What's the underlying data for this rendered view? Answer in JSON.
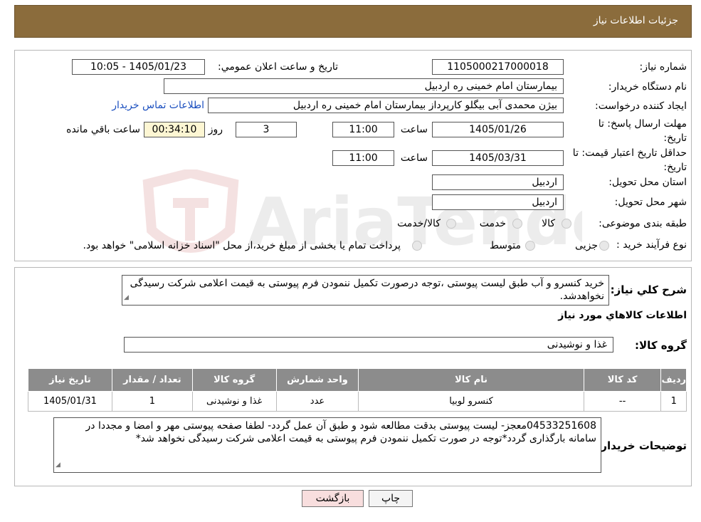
{
  "header": {
    "title": "جزئیات اطلاعات نیاز"
  },
  "form": {
    "need_number_label": "شماره نیاز:",
    "need_number": "1105000217000018",
    "announce_label": "تاریخ و ساعت اعلان عمومي:",
    "announce_value": "1405/01/23 - 10:05",
    "buyer_org_label": "نام دستگاه خریدار:",
    "buyer_org": "بیمارستان امام خمینی  ره  اردبیل",
    "requester_label": "ایجاد کننده درخواست:",
    "requester": "بیژن محمدی آبی بیگلو کارپرداز بیمارستان امام خمینی  ره  اردبیل",
    "contact_link": "اطلاعات تماس خریدار",
    "deadline_label": "مهلت ارسال پاسخ: تا تاریخ:",
    "deadline_date": "1405/01/26",
    "time_label": "ساعت",
    "deadline_time": "11:00",
    "days": "3",
    "days_label": "روز و",
    "remaining": "00:34:10",
    "remaining_label": "ساعت باقي مانده",
    "validity_label": "حداقل تاریخ اعتبار قیمت: تا تاریخ:",
    "validity_date": "1405/03/31",
    "validity_time": "11:00",
    "province_label": "استان محل تحویل:",
    "province": "اردبیل",
    "city_label": "شهر محل تحویل:",
    "city": "اردبیل",
    "category_label": "طبقه بندی موضوعی:",
    "category_options": [
      "کالا",
      "خدمت",
      "کالا/خدمت"
    ],
    "process_label": "نوع فرآیند خرید :",
    "process_options": [
      "جزیی",
      "متوسط"
    ],
    "process_note": "پرداخت تمام یا بخشی از مبلغ خرید،از محل \"اسناد خزانه اسلامی\" خواهد بود."
  },
  "description": {
    "label": "شرح کلي نياز:",
    "text": "خرید کنسرو و آب طبق لیست پیوستی ،توجه درصورت تکمیل ننمودن فرم پیوستی به قیمت اعلامی شرکت رسیدگی نخواهدشد."
  },
  "goods": {
    "section_title": "اطلاعات کالاهاي مورد نياز",
    "group_label": "گروه کالا:",
    "group_value": "غذا و نوشیدنی",
    "columns": [
      "رديف",
      "کد کالا",
      "نام کالا",
      "واحد شمارش",
      "گروه کالا",
      "تعداد / مقدار",
      "تاریخ نیاز"
    ],
    "rows": [
      [
        "1",
        "--",
        "کنسرو لوبیا",
        "عدد",
        "غذا و نوشیدنی",
        "1",
        "1405/01/31"
      ]
    ]
  },
  "buyer_notes": {
    "label": "توضیحات خریدار:",
    "text": "04533251608معجز- لیست پیوستی بدقت مطالعه شود و طبق آن عمل گردد- لطفا صفحه پیوستی مهر و امضا و مجددا در سامانه بارگذاری گردد*توجه در صورت تکمیل ننمودن فرم پیوستی به قیمت اعلامی شرکت رسیدگی نخواهد شد*"
  },
  "buttons": {
    "print": "چاپ",
    "back": "بازگشت"
  },
  "watermark": {
    "text": "AriaTender.neT"
  },
  "colors": {
    "header_bg": "#8b6c3c",
    "table_header_bg": "#8c8c8c",
    "back_button_bg": "#f8dede",
    "remaining_bg": "#fdf6d3",
    "link": "#1b4fbf"
  }
}
